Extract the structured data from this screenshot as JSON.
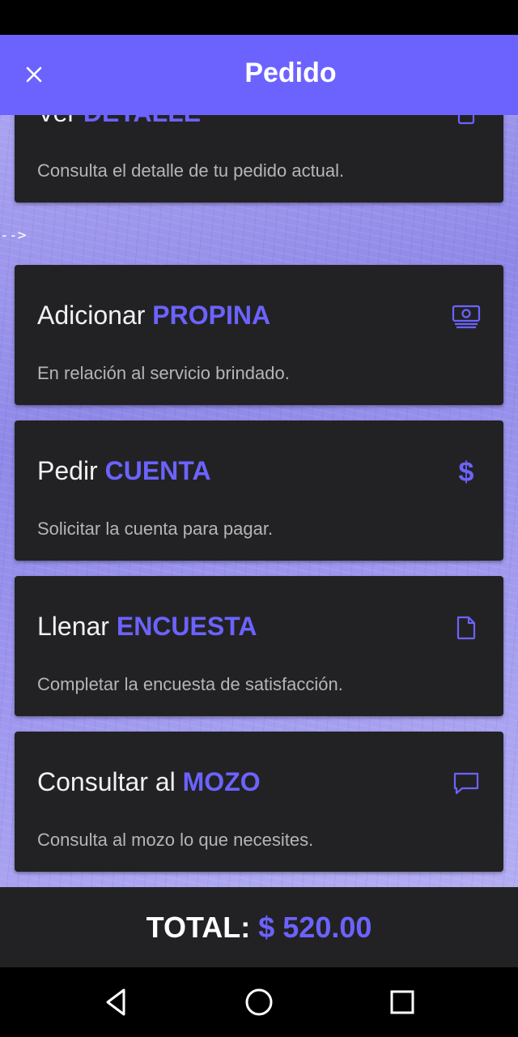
{
  "header": {
    "title": "Pedido",
    "close_icon": "close-icon"
  },
  "cards": [
    {
      "lead": "Ver",
      "accent": "DETALLE",
      "description": "Consulta el detalle de tu pedido actual.",
      "icon": "receipt-icon"
    },
    {
      "lead": "Adicionar",
      "accent": "PROPINA",
      "description": "En relación al servicio brindado.",
      "icon": "cash-icon"
    },
    {
      "lead": "Pedir",
      "accent": "CUENTA",
      "description": "Solicitar la cuenta para pagar.",
      "icon": "dollar-icon",
      "icon_glyph": "$"
    },
    {
      "lead": "Llenar",
      "accent": "ENCUESTA",
      "description": "Completar la encuesta de satisfacción.",
      "icon": "document-icon"
    },
    {
      "lead": "Consultar al",
      "accent": "MOZO",
      "description": "Consulta al mozo lo que necesites.",
      "icon": "chat-icon"
    }
  ],
  "stray_text": "-->",
  "footer": {
    "total_label": "TOTAL:",
    "amount": "$ 520.00"
  },
  "navigation": [
    "back-icon",
    "home-icon",
    "recents-icon"
  ],
  "colors": {
    "accent": "#6c63ff",
    "card": "#222224",
    "background": "#000000"
  }
}
